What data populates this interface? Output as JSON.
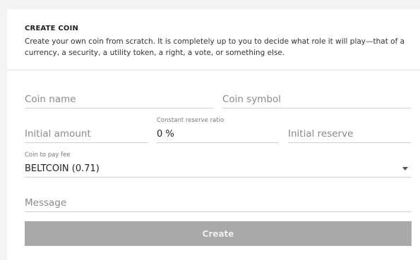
{
  "panel": {
    "title": "CREATE COIN",
    "description": "Create your own coin from scratch. It is completely up to you to decide what role it will play—that of a currency, a security, a utility token, a right, a vote, or something else."
  },
  "form": {
    "coin_name": {
      "placeholder": "Coin name",
      "value": ""
    },
    "coin_symbol": {
      "placeholder": "Coin symbol",
      "value": ""
    },
    "initial_amount": {
      "placeholder": "Initial amount",
      "value": ""
    },
    "reserve_ratio": {
      "label": "Constant reserve ratio",
      "value": "0 %"
    },
    "initial_reserve": {
      "placeholder": "Initial reserve",
      "value": ""
    },
    "fee_coin": {
      "label": "Coin to pay fee",
      "value": "BELTCOIN (0.71)",
      "icon": "chevron-down-icon"
    },
    "message": {
      "placeholder": "Message",
      "value": ""
    },
    "submit_label": "Create"
  },
  "colors": {
    "button_bg": "#a9a9a9",
    "button_text": "#ededed",
    "underline": "#cfcfcf"
  }
}
